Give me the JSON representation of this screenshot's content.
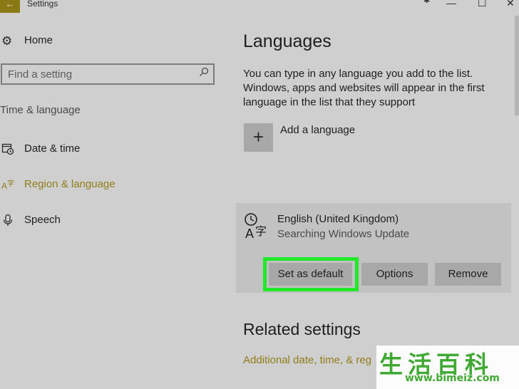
{
  "window": {
    "title": "Settings",
    "back_icon": "←",
    "pin_icon": "✱",
    "minimize_icon": "—",
    "maximize_icon": "☐",
    "close_icon": "✕"
  },
  "sidebar": {
    "home_label": "Home",
    "search_placeholder": "Find a setting",
    "section_label": "Time & language",
    "items": [
      {
        "label": "Date & time",
        "icon": "calendar-clock-icon",
        "active": false
      },
      {
        "label": "Region & language",
        "icon": "language-icon",
        "active": true
      },
      {
        "label": "Speech",
        "icon": "microphone-icon",
        "active": false
      }
    ]
  },
  "main": {
    "heading": "Languages",
    "description": "You can type in any language you add to the list. Windows, apps and websites will appear in the first language in the list that they support",
    "add_language_label": "Add a language",
    "language": {
      "name": "English (United Kingdom)",
      "status": "Searching Windows Update"
    },
    "buttons": {
      "set_default": "Set as default",
      "options": "Options",
      "remove": "Remove"
    },
    "related_heading": "Related settings",
    "related_link": "Additional date, time, & reg"
  },
  "colors": {
    "accent": "#8f7d1a",
    "highlight": "#22e82a",
    "background": "#cfcfcf"
  },
  "watermark": {
    "chars": "生活百科",
    "url": "www.bimeiz.com"
  }
}
